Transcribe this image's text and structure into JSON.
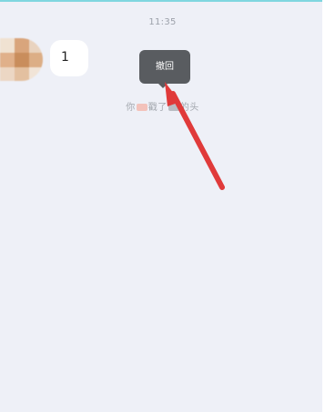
{
  "status": {
    "time": "11:35"
  },
  "message": {
    "text": "1"
  },
  "context_menu": {
    "recall_label": "撤回"
  },
  "system_notice": {
    "prefix": "你",
    "middle": "戳了",
    "suffix": "的头"
  },
  "colors": {
    "background": "#eef0f7",
    "tooltip": "#595c60",
    "annotation_arrow": "#e03a3a"
  },
  "icons": {
    "annotation": "red-arrow-pointer"
  }
}
